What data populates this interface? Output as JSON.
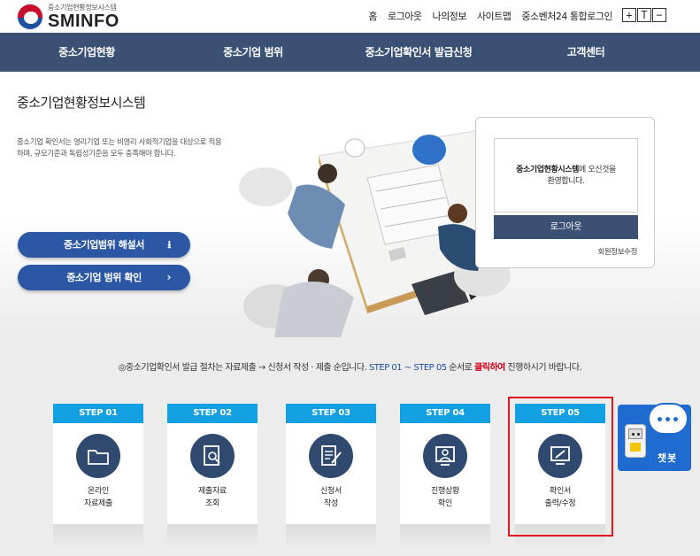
{
  "header": {
    "logo_sub": "중소기업현황정보시스템",
    "logo_main": "SMINFO",
    "links": [
      "홈",
      "로그아웃",
      "나의정보",
      "사이트맵",
      "중소벤처24 통합로그인"
    ],
    "font_controls": [
      "+",
      "T",
      "−"
    ]
  },
  "nav": {
    "items": [
      "중소기업현황",
      "중소기업 범위",
      "중소기업확인서 발급신청",
      "고객센터"
    ]
  },
  "hero": {
    "title": "중소기업현황정보시스템",
    "description": "중소기업 확인서는 영리기업 또는 비영리 사회적기업을 대상으로 적용하며, 규모기준과 독립성기준을 모두 충족해야 합니다.",
    "btn_guide": "중소기업범위 해설서",
    "btn_check": "중소기업 범위 확인"
  },
  "login": {
    "welcome_strong": "중소기업현황시스템",
    "welcome_rest": "에 오신것을",
    "welcome_line2": "환영합니다.",
    "logout_label": "로그아웃",
    "member_edit": "회원정보수정"
  },
  "process": {
    "notice_prefix": "◎중소기업확인서 발급 절차는 자료제출 → 신청서 작성 · 제출 순입니다. ",
    "notice_steps": "STEP 01 ~ STEP 05",
    "notice_mid": " 순서로 ",
    "notice_click": "클릭하여",
    "notice_suffix": " 진행하시기 바랍니다.",
    "steps": [
      {
        "step": "STEP 01",
        "line1": "온라인",
        "line2": "자료제출",
        "icon": "folder-icon"
      },
      {
        "step": "STEP 02",
        "line1": "제출자료",
        "line2": "조회",
        "icon": "document-search-icon"
      },
      {
        "step": "STEP 03",
        "line1": "신청서",
        "line2": "작성",
        "icon": "document-edit-icon"
      },
      {
        "step": "STEP 04",
        "line1": "진행상황",
        "line2": "확인",
        "icon": "monitor-user-icon"
      },
      {
        "step": "STEP 05",
        "line1": "확인서",
        "line2": "출력/수정",
        "icon": "monitor-edit-icon"
      }
    ],
    "chatbot_label": "챗봇"
  },
  "colors": {
    "nav_bg": "#3b5174",
    "pill_blue": "#2c57a4",
    "step_tab": "#12a0e2",
    "icon_circle": "#2f4a6e",
    "highlight": "#e0181e",
    "chatbot": "#1f6bcf"
  }
}
